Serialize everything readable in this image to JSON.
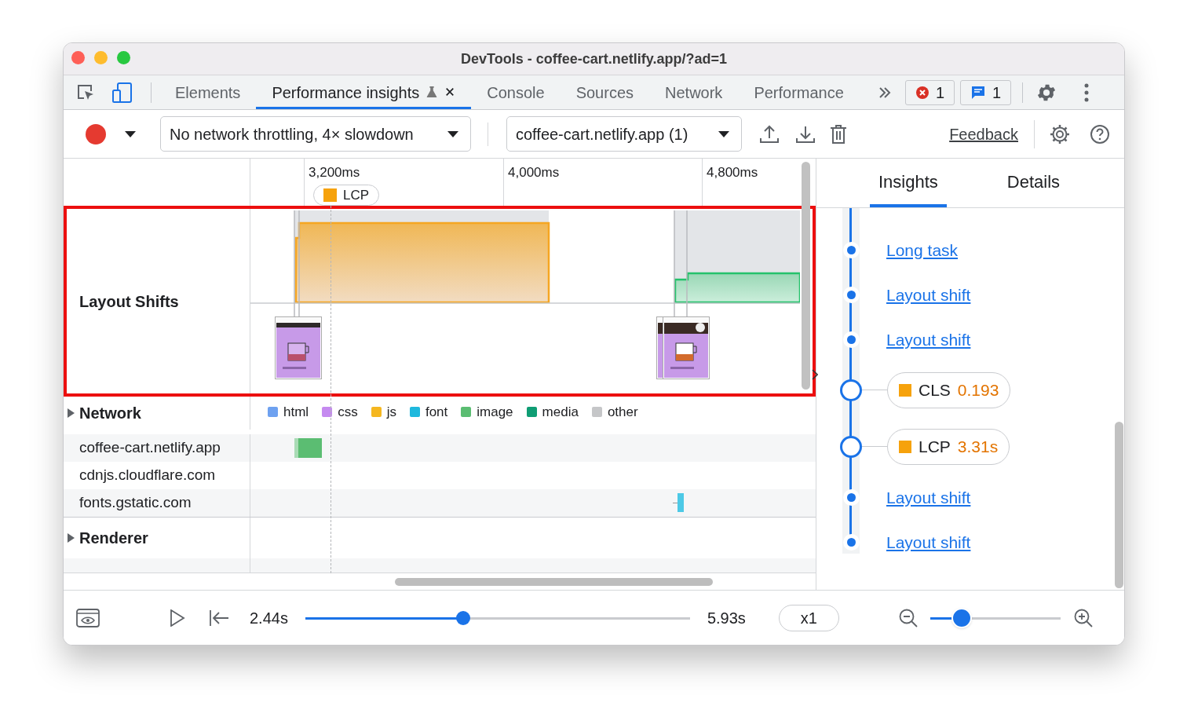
{
  "window": {
    "title": "DevTools - coffee-cart.netlify.app/?ad=1"
  },
  "tabs": [
    {
      "label": "Elements",
      "selected": false,
      "closable": false,
      "experimental": false
    },
    {
      "label": "Performance insights",
      "selected": true,
      "closable": true,
      "experimental": true
    },
    {
      "label": "Console",
      "selected": false,
      "closable": false,
      "experimental": false
    },
    {
      "label": "Sources",
      "selected": false,
      "closable": false,
      "experimental": false
    },
    {
      "label": "Network",
      "selected": false,
      "closable": false,
      "experimental": false
    },
    {
      "label": "Performance",
      "selected": false,
      "closable": false,
      "experimental": false
    }
  ],
  "badges": [
    {
      "kind": "error",
      "count": "1"
    },
    {
      "kind": "message",
      "count": "1"
    }
  ],
  "toolbar": {
    "throttling": "No network throttling, 4× slowdown",
    "recording": "coffee-cart.netlify.app (1)",
    "feedback": "Feedback"
  },
  "timeline": {
    "ticks": [
      "3,200ms",
      "4,000ms",
      "4,800ms"
    ],
    "marker": "LCP",
    "layout_shifts": {
      "label": "Layout Shifts",
      "highlighted": true
    },
    "network": {
      "label": "Network",
      "expanded": false,
      "legend": [
        {
          "label": "html",
          "color": "#6ea1f0"
        },
        {
          "label": "css",
          "color": "#c58af0"
        },
        {
          "label": "js",
          "color": "#f5b720"
        },
        {
          "label": "font",
          "color": "#1fb8dd"
        },
        {
          "label": "image",
          "color": "#5bbd72"
        },
        {
          "label": "media",
          "color": "#0f9d74"
        },
        {
          "label": "other",
          "color": "#c5c6c8"
        }
      ],
      "hosts": [
        "coffee-cart.netlify.app",
        "cdnjs.cloudflare.com",
        "fonts.gstatic.com"
      ]
    },
    "groups": [
      {
        "label": "Renderer",
        "expanded": false
      }
    ]
  },
  "insights": {
    "tabs": [
      {
        "label": "Insights",
        "selected": true
      },
      {
        "label": "Details",
        "selected": false
      }
    ],
    "items": [
      {
        "kind": "link",
        "label": "Long task"
      },
      {
        "kind": "link",
        "label": "Layout shift"
      },
      {
        "kind": "link",
        "label": "Layout shift"
      },
      {
        "kind": "metric",
        "label": "CLS",
        "value": "0.193"
      },
      {
        "kind": "metric",
        "label": "LCP",
        "value": "3.31s"
      },
      {
        "kind": "link",
        "label": "Layout shift"
      },
      {
        "kind": "link",
        "label": "Layout shift"
      }
    ]
  },
  "playback": {
    "start": "2.44s",
    "end": "5.93s",
    "level": 0.41,
    "speed": "x1"
  },
  "zoom": {
    "level": 0.24
  }
}
